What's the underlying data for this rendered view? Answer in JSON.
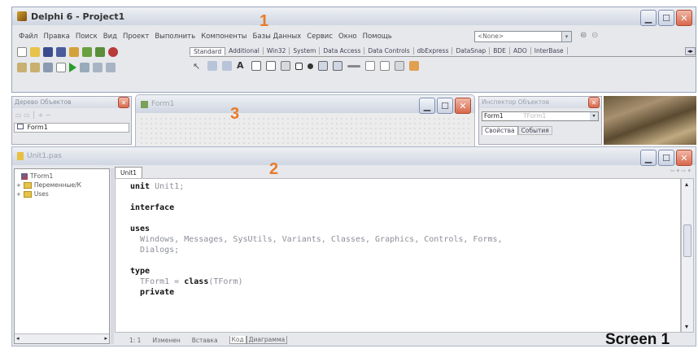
{
  "main_window": {
    "title": "Delphi 6 - Project1",
    "menu": [
      "Файл",
      "Правка",
      "Поиск",
      "Вид",
      "Проект",
      "Выполнить",
      "Компоненты",
      "Базы Данных",
      "Сервис",
      "Окно",
      "Помощь"
    ],
    "desktop_combo_value": "<None>",
    "palette_tabs": [
      "Standard",
      "Additional",
      "Win32",
      "System",
      "Data Access",
      "Data Controls",
      "dbExpress",
      "DataSnap",
      "BDE",
      "ADO",
      "InterBase"
    ]
  },
  "object_tree": {
    "title": "Дерево Объектов",
    "item": "Form1"
  },
  "form_window": {
    "title": "Form1"
  },
  "object_inspector": {
    "title": "Инспектор Объектов",
    "selected": "Form1",
    "selected_type": "TForm1",
    "tabs": [
      "Свойства",
      "События"
    ]
  },
  "code_editor": {
    "title": "Unit1.pas",
    "tab": "Unit1",
    "explorer_items": [
      "TForm1",
      "Переменные/К",
      "Uses"
    ],
    "status_position": "1: 1",
    "status_modified": "Изменен",
    "status_mode": "Вставка",
    "bottom_tabs": [
      "Код",
      "Диаграмма"
    ]
  },
  "code_lines": [
    [
      {
        "t": "unit ",
        "k": true
      },
      {
        "t": "Unit1;",
        "m": true
      }
    ],
    [],
    [
      {
        "t": "interface",
        "k": true
      }
    ],
    [],
    [
      {
        "t": "uses",
        "k": true
      }
    ],
    [
      {
        "t": "  Windows, Messages, SysUtils, Variants, Classes, Graphics, Controls, Forms,",
        "m": true
      }
    ],
    [
      {
        "t": "  Dialogs;",
        "m": true
      }
    ],
    [],
    [
      {
        "t": "type",
        "k": true
      }
    ],
    [
      {
        "t": "  TForm1 = ",
        "m": true
      },
      {
        "t": "class",
        "k": true
      },
      {
        "t": "(TForm)",
        "m": true
      }
    ],
    [
      {
        "t": "  private",
        "k": true
      }
    ]
  ],
  "annotations": {
    "n1": "1",
    "n2": "2",
    "n3": "3"
  },
  "caption": "Screen 1"
}
